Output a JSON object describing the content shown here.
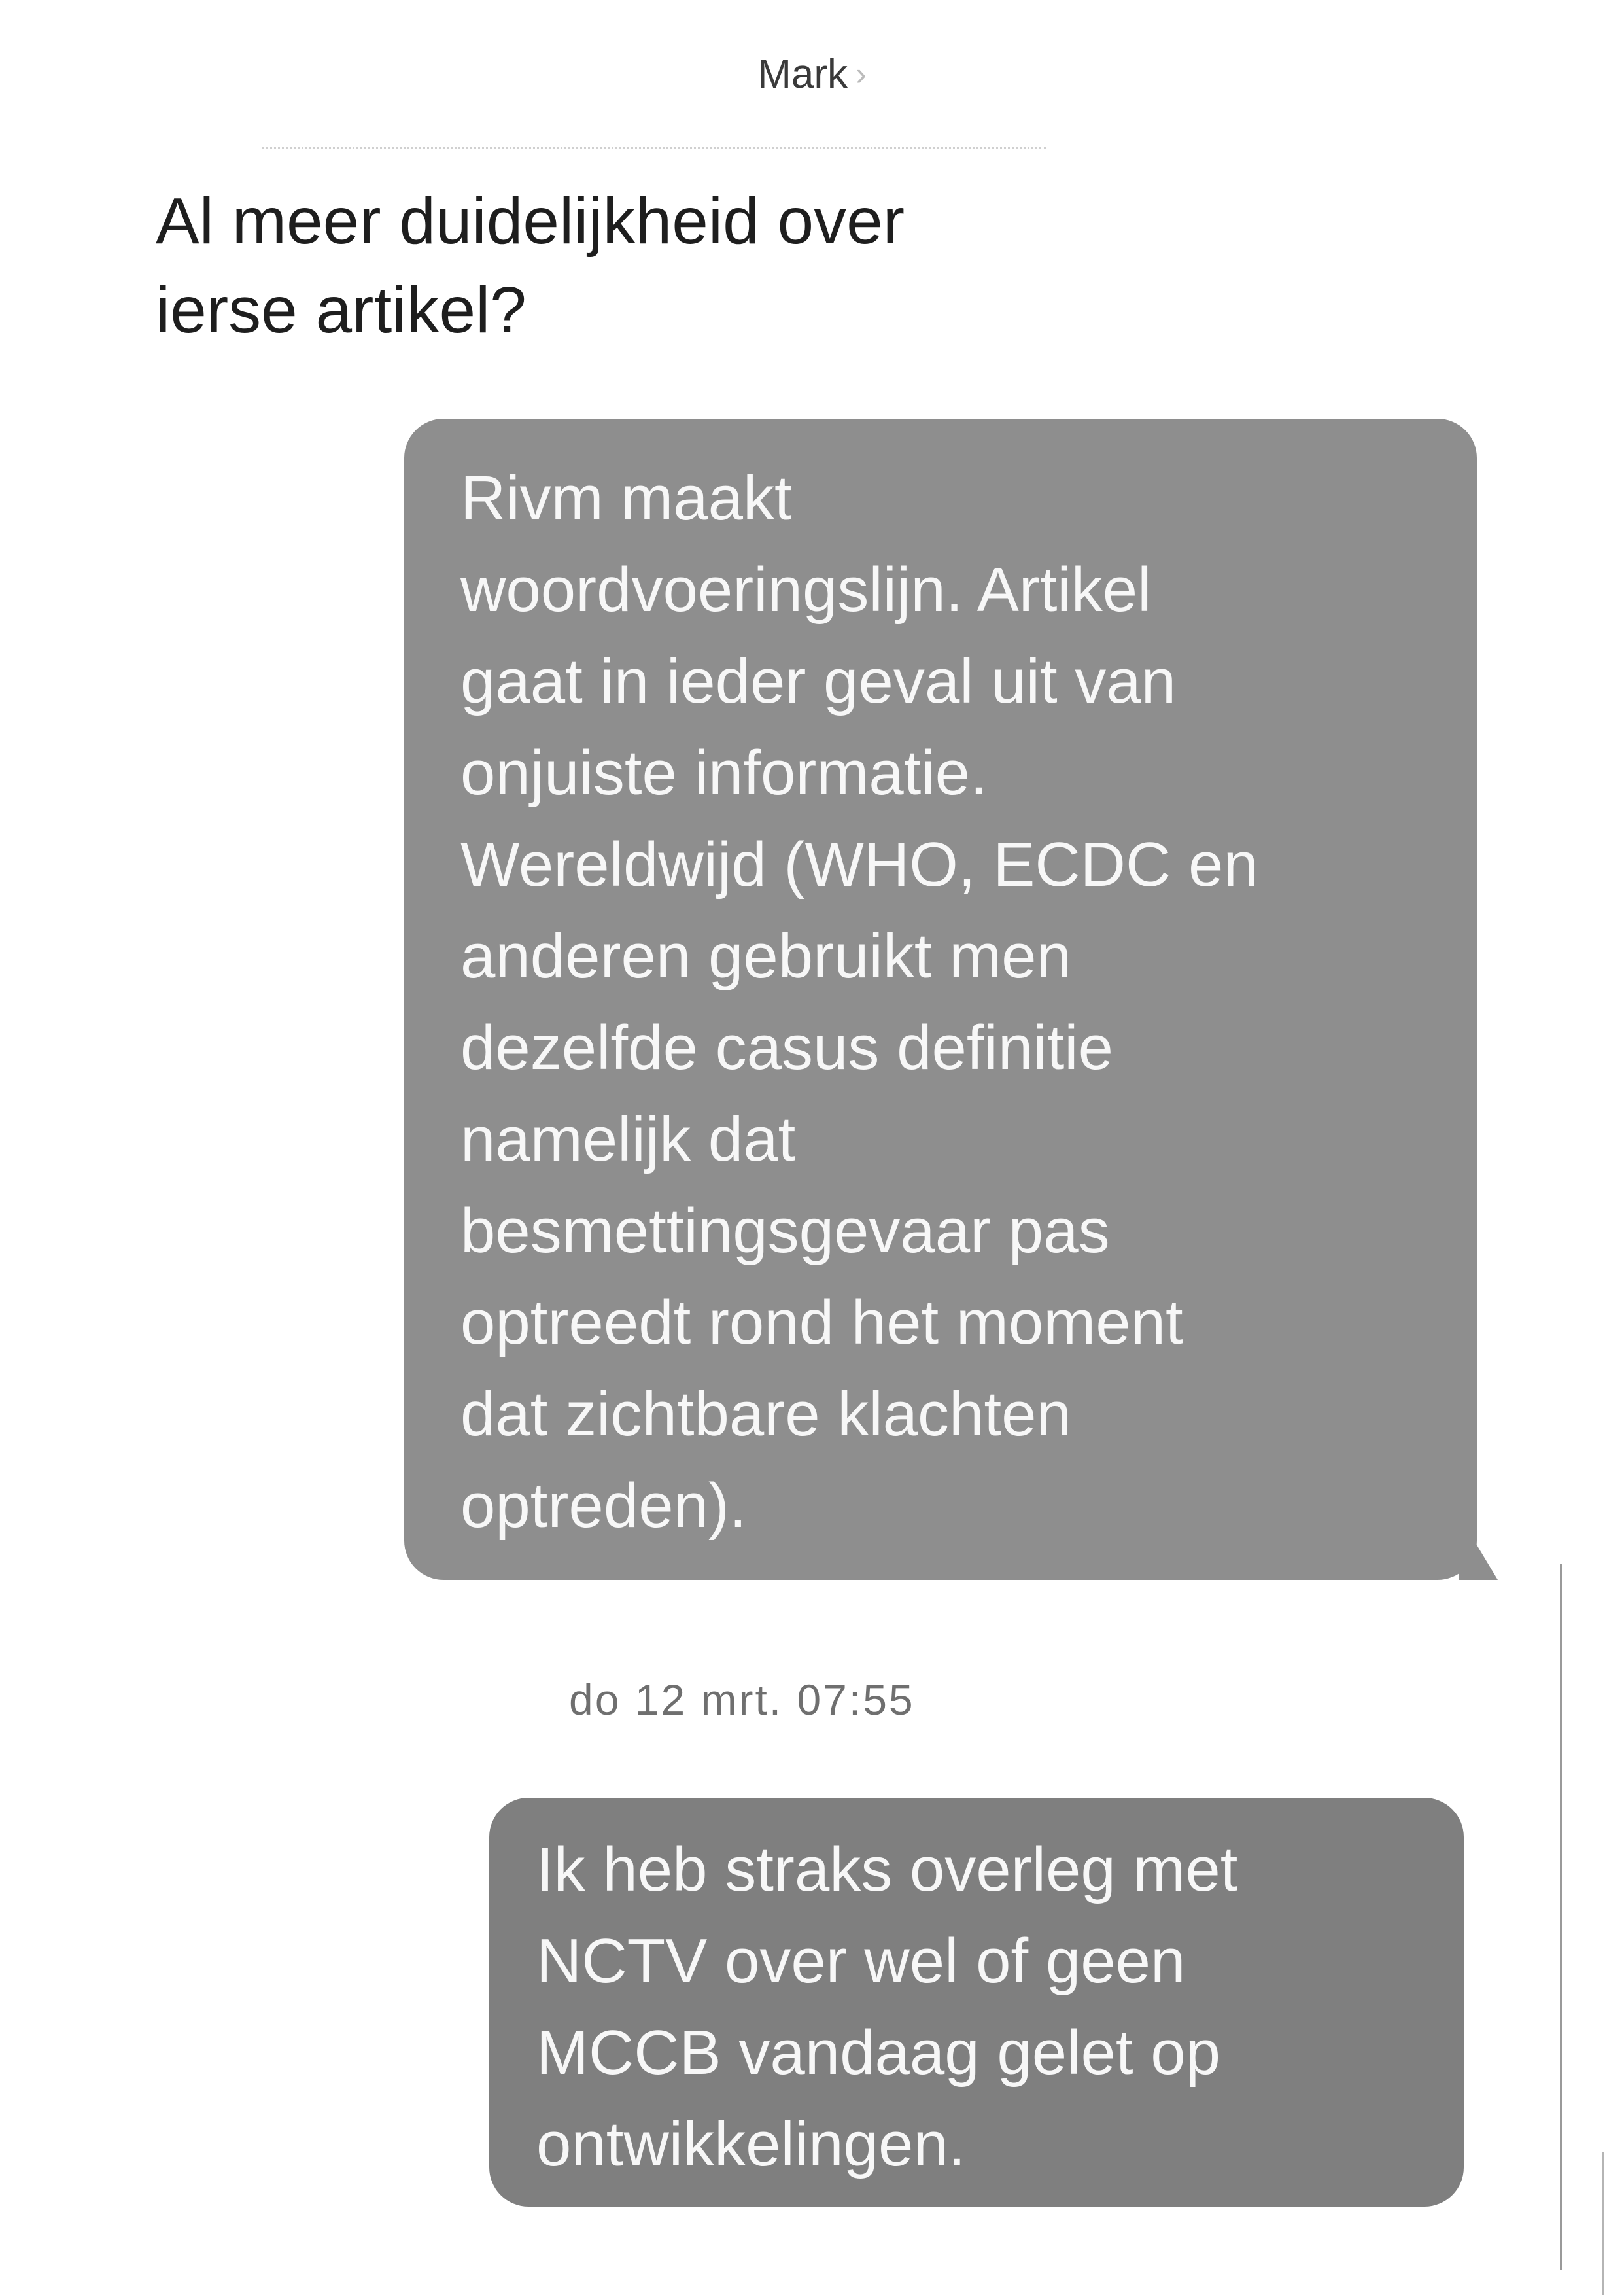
{
  "header": {
    "contact_name": "Mark",
    "chevron_glyph": "›",
    "chevron_icon": "chevron-right-icon"
  },
  "messages": [
    {
      "direction": "incoming",
      "text": "Al meer duidelijkheid over\nierse artikel?"
    },
    {
      "direction": "outgoing",
      "text": "Rivm maakt\nwoordvoeringslijn. Artikel\ngaat in ieder geval uit van\nonjuiste informatie.\nWereldwijd (WHO, ECDC en\nanderen gebruikt men\ndezelfde casus definitie\nnamelijk dat\nbesmettingsgevaar pas\noptreedt rond het moment\ndat zichtbare klachten\noptreden)."
    },
    {
      "direction": "timestamp",
      "text": "do 12 mrt. 07:55"
    },
    {
      "direction": "outgoing",
      "text": "Ik heb straks overleg met\nNCTV over wel of geen\nMCCB vandaag gelet op\nontwikkelingen."
    }
  ],
  "colors": {
    "outgoing_bubble": "#8e8e8e",
    "outgoing_text": "#f7f7f7",
    "incoming_text": "#1e1e1e",
    "timestamp": "#6f6f6f"
  }
}
